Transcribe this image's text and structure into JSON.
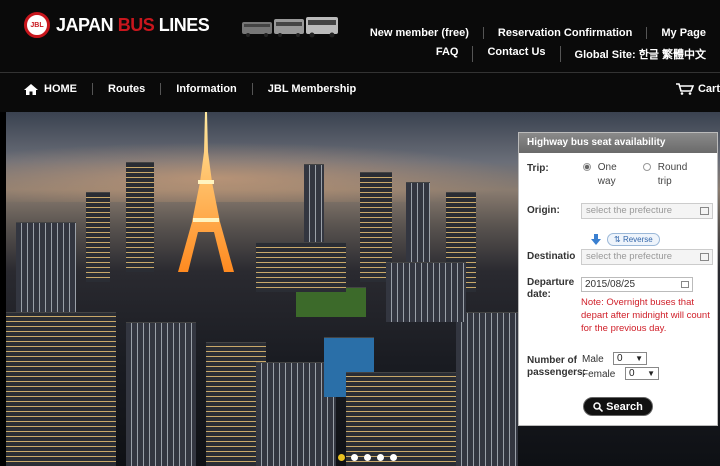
{
  "brand": {
    "logo_badge": "JBL",
    "name_part1": "JAPAN",
    "name_part2": "BUS",
    "name_part3": "LINES"
  },
  "toplinks": {
    "row1": [
      "New member (free)",
      "Reservation Confirmation",
      "My Page"
    ],
    "row2": [
      "FAQ",
      "Contact Us",
      "Global Site: 한글 繁體中文"
    ]
  },
  "nav": {
    "home": "HOME",
    "routes": "Routes",
    "information": "Information",
    "membership": "JBL Membership",
    "cart": "Cart"
  },
  "carousel": {
    "slide_count": 5,
    "active_index": 1
  },
  "panel": {
    "title": "Highway bus seat availability",
    "trip_label": "Trip:",
    "trip_one_way": "One way",
    "trip_round": "Round trip",
    "trip_selected": "one_way",
    "origin_label": "Origin:",
    "origin_placeholder": "select the prefecture",
    "reverse_label": "Reverse",
    "destination_label": "Destinatio",
    "destination_placeholder": "select the prefecture",
    "departure_label": "Departure date:",
    "departure_value": "2015/08/25",
    "note": "Note: Overnight buses that depart after midnight will count for the previous day.",
    "passengers_label": "Number of passengers:",
    "male_label": "Male",
    "male_value": "0",
    "female_label": "Female",
    "female_value": "0",
    "search_label": "Search"
  },
  "colors": {
    "brand_red": "#c8161d",
    "header_bg": "#0a0a0a",
    "note_red": "#d0202a",
    "active_dot": "#e8c020"
  }
}
